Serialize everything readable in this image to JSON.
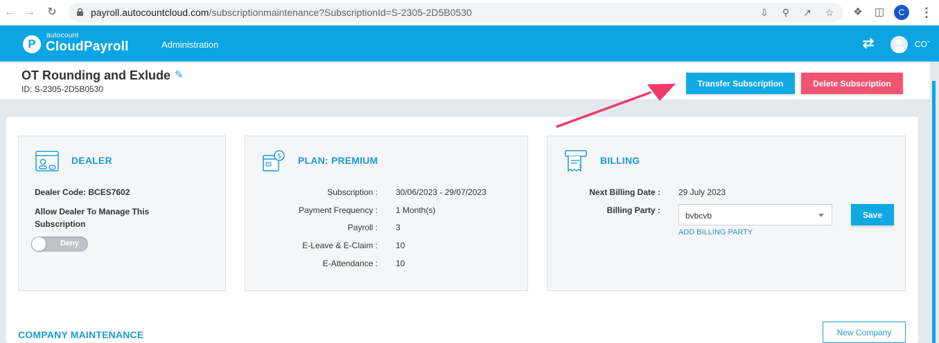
{
  "browser": {
    "url_host": "payroll.autocountcloud.com",
    "url_path": "/subscriptionmaintenance?SubscriptionId=S-2305-2D5B0530",
    "profile_initial": "C",
    "icons": [
      "back-icon",
      "forward-icon",
      "reload-icon",
      "lock-icon",
      "download-icon",
      "zoom-icon",
      "share-icon",
      "bookmark-star-icon",
      "extensions-icon",
      "side-panel-icon",
      "menu-kebab-icon"
    ]
  },
  "app": {
    "logo_small": "autocount",
    "logo_main": "CloudPayroll",
    "logo_letter": "P",
    "nav_admin": "Administration",
    "user_initials": "CO",
    "accent_color": "#0ba5e3"
  },
  "subscription": {
    "title": "OT Rounding and Exlude",
    "id_text": "ID: S-2305-2D5B0530",
    "transfer_label": "Transfer Subscription",
    "delete_label": "Delete Subscription",
    "delete_color": "#f25472"
  },
  "dealer": {
    "title": "DEALER",
    "code_text": "Dealer Code: BCES7602",
    "allow_label": "Allow Dealer To Manage This Subscription",
    "toggle_label": "Deny"
  },
  "plan": {
    "title": "PLAN: PREMIUM",
    "rows": [
      {
        "key": "Subscription :",
        "value": "30/06/2023 - 29/07/2023"
      },
      {
        "key": "Payment Frequency :",
        "value": "1 Month(s)"
      },
      {
        "key": "Payroll :",
        "value": "3"
      },
      {
        "key": "E-Leave & E-Claim :",
        "value": "10"
      },
      {
        "key": "E-Attendance :",
        "value": "10"
      }
    ]
  },
  "billing": {
    "title": "BILLING",
    "next_date_key": "Next Billing Date :",
    "next_date_value": "29 July 2023",
    "party_key": "Billing Party :",
    "party_value": "bvbcvb",
    "add_party_label": "ADD BILLING PARTY",
    "save_label": "Save"
  },
  "company": {
    "title": "COMPANY MAINTENANCE",
    "new_label": "New Company"
  },
  "annotation": {
    "arrow_color": "#f0386b"
  }
}
